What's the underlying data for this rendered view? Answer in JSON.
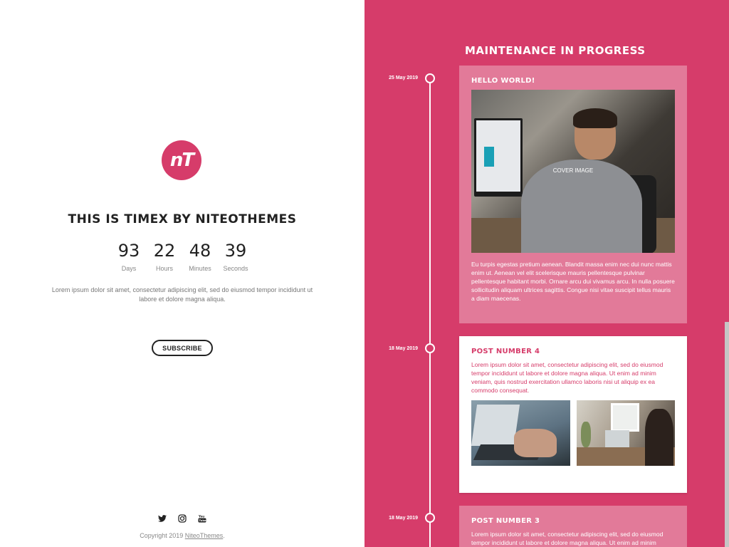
{
  "left": {
    "logo_text": "nT",
    "title": "THIS IS TIMEX BY NITEOTHEMES",
    "countdown": [
      {
        "value": "93",
        "label": "Days"
      },
      {
        "value": "22",
        "label": "Hours"
      },
      {
        "value": "48",
        "label": "Minutes"
      },
      {
        "value": "39",
        "label": "Seconds"
      }
    ],
    "intro": "Lorem ipsum dolor sit amet, consectetur adipiscing elit, sed do eiusmod tempor incididunt ut labore et dolore magna aliqua.",
    "subscribe_label": "SUBSCRIBE",
    "socials": [
      "twitter-icon",
      "instagram-icon",
      "youtube-icon"
    ],
    "copyright_prefix": "Copyright 2019 ",
    "copyright_link": "NiteoThemes",
    "copyright_suffix": "."
  },
  "right": {
    "title": "MAINTENANCE IN PROGRESS",
    "posts": [
      {
        "date": "25 May 2019",
        "title": "HELLO WORLD!",
        "image_label": "COVER IMAGE",
        "text": "Eu turpis egestas pretium aenean. Blandit massa enim nec dui nunc mattis enim ut. Aenean vel elit scelerisque mauris pellentesque pulvinar pellentesque habitant morbi. Ornare arcu dui vivamus arcu. In nulla posuere sollicitudin aliquam ultrices sagittis. Congue nisi vitae suscipit tellus mauris a diam maecenas."
      },
      {
        "date": "18 May 2019",
        "title": "POST NUMBER 4",
        "text": "Lorem ipsum dolor sit amet, consectetur adipiscing elit, sed do eiusmod tempor incididunt ut labore et dolore magna aliqua. Ut enim ad minim veniam, quis nostrud exercitation ullamco laboris nisi ut aliquip ex ea commodo consequat."
      },
      {
        "date": "18 May 2019",
        "title": "POST NUMBER 3",
        "text": "Lorem ipsum dolor sit amet, consectetur adipiscing elit, sed do eiusmod tempor incididunt ut labore et dolore magna aliqua. Ut enim ad minim veniam"
      }
    ]
  },
  "colors": {
    "accent": "#d63c6a",
    "card_light": "#e27a99",
    "text_dark": "#222222"
  }
}
